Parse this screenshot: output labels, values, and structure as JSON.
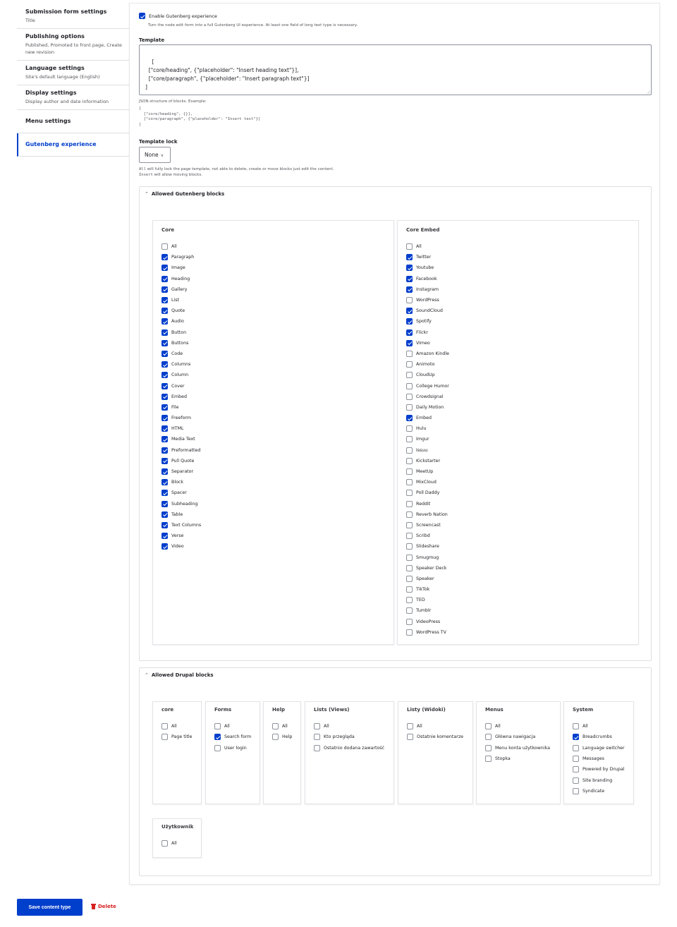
{
  "sidebar": {
    "tabs": [
      {
        "title": "Submission form settings",
        "summary": "Title"
      },
      {
        "title": "Publishing options",
        "summary": "Published, Promoted to front page, Create new revision"
      },
      {
        "title": "Language settings",
        "summary": "Site's default language (English)"
      },
      {
        "title": "Display settings",
        "summary": "Display author and date information"
      },
      {
        "title": "Menu settings",
        "summary": ""
      },
      {
        "title": "Gutenberg experience",
        "summary": "",
        "active": true
      }
    ]
  },
  "gutenberg": {
    "enable_label": "Enable Gutenberg experience",
    "enable_checked": true,
    "enable_description": "Turn the node edit form into a full Gutenberg UI experience. At least one field of long text type is necessary.",
    "template_label": "Template",
    "template_value": "[\n  [\"core/heading\", {\"placeholder\": \"Insert heading text\"}],\n  [\"core/paragraph\", {\"placeholder\": \"Insert paragraph text\"}]\n]",
    "template_description": "JSON structure of blocks. Example:",
    "template_example": "[\n  [\"core/heading\", {}],\n  [\"core/paragraph\", {\"placeholder\": \"Insert text\"}]\n]",
    "template_lock_label": "Template lock",
    "template_lock_value": "None",
    "lock_desc_all_code": "All",
    "lock_desc_all_text": " will fully lock the page template, not able to delete, create or move blocks just edit the content.",
    "lock_desc_insert_code": "Insert",
    "lock_desc_insert_text": " will allow moving blocks."
  },
  "allowed_gutenberg_blocks": {
    "title": "Allowed Gutenberg blocks",
    "groups": [
      {
        "title": "Core",
        "items": [
          {
            "label": "All",
            "checked": false
          },
          {
            "label": "Paragraph",
            "checked": true
          },
          {
            "label": "Image",
            "checked": true
          },
          {
            "label": "Heading",
            "checked": true
          },
          {
            "label": "Gallery",
            "checked": true
          },
          {
            "label": "List",
            "checked": true
          },
          {
            "label": "Quote",
            "checked": true
          },
          {
            "label": "Audio",
            "checked": true
          },
          {
            "label": "Button",
            "checked": true
          },
          {
            "label": "Buttons",
            "checked": true
          },
          {
            "label": "Code",
            "checked": true
          },
          {
            "label": "Columns",
            "checked": true
          },
          {
            "label": "Column",
            "checked": true
          },
          {
            "label": "Cover",
            "checked": true
          },
          {
            "label": "Embed",
            "checked": true
          },
          {
            "label": "File",
            "checked": true
          },
          {
            "label": "Freeform",
            "checked": true
          },
          {
            "label": "HTML",
            "checked": true
          },
          {
            "label": "Media Text",
            "checked": true
          },
          {
            "label": "Preformatted",
            "checked": true
          },
          {
            "label": "Pull Quote",
            "checked": true
          },
          {
            "label": "Separator",
            "checked": true
          },
          {
            "label": "Block",
            "checked": true
          },
          {
            "label": "Spacer",
            "checked": true
          },
          {
            "label": "Subheading",
            "checked": true
          },
          {
            "label": "Table",
            "checked": true
          },
          {
            "label": "Text Columns",
            "checked": true
          },
          {
            "label": "Verse",
            "checked": true
          },
          {
            "label": "Video",
            "checked": true
          }
        ]
      },
      {
        "title": "Core Embed",
        "items": [
          {
            "label": "All",
            "checked": false
          },
          {
            "label": "Twitter",
            "checked": true
          },
          {
            "label": "Youtube",
            "checked": true
          },
          {
            "label": "Facebook",
            "checked": true
          },
          {
            "label": "Instagram",
            "checked": true
          },
          {
            "label": "WordPress",
            "checked": false
          },
          {
            "label": "SoundCloud",
            "checked": true
          },
          {
            "label": "Spotify",
            "checked": true
          },
          {
            "label": "Flickr",
            "checked": true
          },
          {
            "label": "Vimeo",
            "checked": true
          },
          {
            "label": "Amazon Kindle",
            "checked": false
          },
          {
            "label": "Animoto",
            "checked": false
          },
          {
            "label": "CloudUp",
            "checked": false
          },
          {
            "label": "College Humor",
            "checked": false
          },
          {
            "label": "Crowdsignal",
            "checked": false
          },
          {
            "label": "Daily Motion",
            "checked": false
          },
          {
            "label": "Embed",
            "checked": true
          },
          {
            "label": "Hulu",
            "checked": false
          },
          {
            "label": "Imgur",
            "checked": false
          },
          {
            "label": "Issuu",
            "checked": false
          },
          {
            "label": "Kickstarter",
            "checked": false
          },
          {
            "label": "MeetUp",
            "checked": false
          },
          {
            "label": "MixCloud",
            "checked": false
          },
          {
            "label": "Poll Daddy",
            "checked": false
          },
          {
            "label": "Reddit",
            "checked": false
          },
          {
            "label": "Reverb Nation",
            "checked": false
          },
          {
            "label": "Screencast",
            "checked": false
          },
          {
            "label": "Scribd",
            "checked": false
          },
          {
            "label": "Slideshare",
            "checked": false
          },
          {
            "label": "Smugmug",
            "checked": false
          },
          {
            "label": "Speaker Deck",
            "checked": false
          },
          {
            "label": "Speaker",
            "checked": false
          },
          {
            "label": "TikTok",
            "checked": false
          },
          {
            "label": "TED",
            "checked": false
          },
          {
            "label": "Tumblr",
            "checked": false
          },
          {
            "label": "VideoPress",
            "checked": false
          },
          {
            "label": "WordPress TV",
            "checked": false
          }
        ]
      }
    ]
  },
  "allowed_drupal_blocks": {
    "title": "Allowed Drupal blocks",
    "groups": [
      {
        "title": "core",
        "items": [
          {
            "label": "All",
            "checked": false
          },
          {
            "label": "Page title",
            "checked": false
          }
        ]
      },
      {
        "title": "Forms",
        "items": [
          {
            "label": "All",
            "checked": false
          },
          {
            "label": "Search form",
            "checked": true
          },
          {
            "label": "User login",
            "checked": false
          }
        ]
      },
      {
        "title": "Help",
        "items": [
          {
            "label": "All",
            "checked": false
          },
          {
            "label": "Help",
            "checked": false
          }
        ]
      },
      {
        "title": "Lists (Views)",
        "items": [
          {
            "label": "All",
            "checked": false
          },
          {
            "label": "Kto przegląda",
            "checked": false
          },
          {
            "label": "Ostatnio dodana zawartość",
            "checked": false
          }
        ]
      },
      {
        "title": "Listy (Widoki)",
        "items": [
          {
            "label": "All",
            "checked": false
          },
          {
            "label": "Ostatnie komentarze",
            "checked": false
          }
        ]
      },
      {
        "title": "Menus",
        "items": [
          {
            "label": "All",
            "checked": false
          },
          {
            "label": "Główna nawigacja",
            "checked": false
          },
          {
            "label": "Menu konta użytkownika",
            "checked": false
          },
          {
            "label": "Stopka",
            "checked": false
          }
        ]
      },
      {
        "title": "System",
        "items": [
          {
            "label": "All",
            "checked": false
          },
          {
            "label": "Breadcrumbs",
            "checked": true
          },
          {
            "label": "Language switcher",
            "checked": false
          },
          {
            "label": "Messages",
            "checked": false
          },
          {
            "label": "Powered by Drupal",
            "checked": false
          },
          {
            "label": "Site branding",
            "checked": false
          },
          {
            "label": "Syndicate",
            "checked": false
          }
        ]
      },
      {
        "title": "Użytkownik",
        "items": [
          {
            "label": "All",
            "checked": false
          }
        ]
      }
    ]
  },
  "actions": {
    "save_label": "Save content type",
    "delete_label": "Delete"
  },
  "colors": {
    "accent": "#003ecc",
    "danger": "#d72222"
  }
}
